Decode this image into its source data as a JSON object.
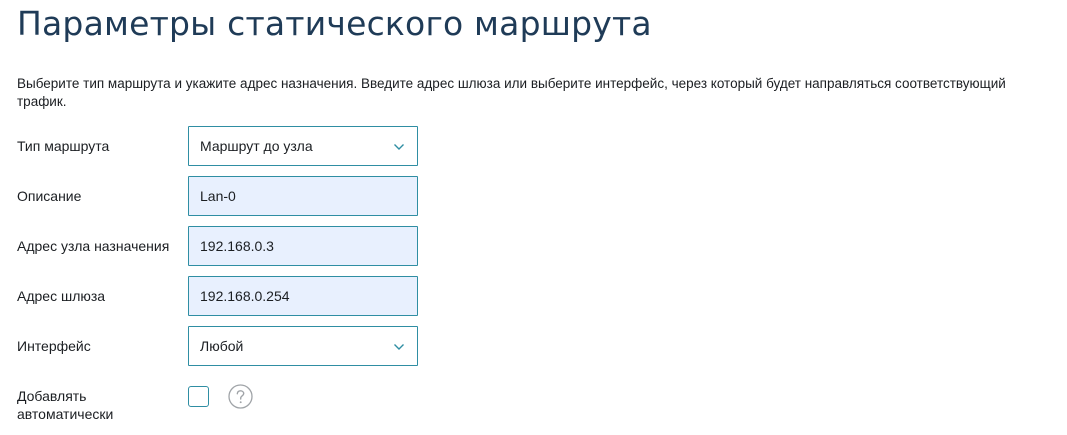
{
  "page": {
    "title": "Параметры статического маршрута",
    "description": "Выберите тип маршрута и укажите адрес назначения. Введите адрес шлюза или выберите интерфейс, через который будет направляться соответствующий трафик."
  },
  "form": {
    "route_type": {
      "label": "Тип маршрута",
      "value": "Маршрут до узла"
    },
    "description_field": {
      "label": "Описание",
      "value": "Lan-0"
    },
    "destination": {
      "label": "Адрес узла назначения",
      "value": "192.168.0.3"
    },
    "gateway": {
      "label": "Адрес шлюза",
      "value": "192.168.0.254"
    },
    "interface": {
      "label": "Интерфейс",
      "value": "Любой"
    },
    "auto_add": {
      "label": "Добавлять автоматически",
      "checked": false
    }
  },
  "icons": {
    "select_arrow": "chevron-down-icon",
    "help": "question-circle-icon"
  },
  "colors": {
    "title": "#1f3b57",
    "border_accent": "#2f8ea3",
    "autofill_bg": "#e8f0fe",
    "help_icon": "#a0a4a8"
  }
}
